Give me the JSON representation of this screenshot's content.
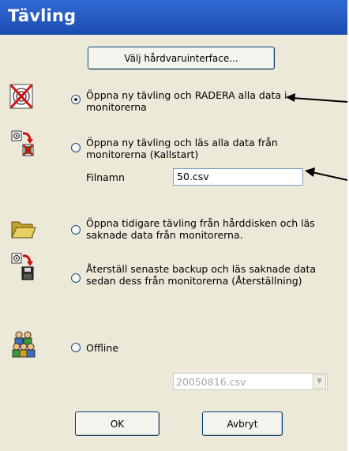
{
  "window": {
    "title": "Tävling"
  },
  "hw_button": {
    "label": "Välj hårdvaruinterface..."
  },
  "options": [
    {
      "text": "Öppna ny tävling och RADERA alla data i monitorerna",
      "checked": true,
      "icon": "wireless-delete-icon"
    },
    {
      "text": "Öppna ny tävling och läs alla data från monitorerna (Kallstart)",
      "checked": false,
      "icon": "read-monitor-cold-start-icon"
    },
    {
      "text": "Öppna tidigare tävling från hårddisken och läs saknade data från monitorerna.",
      "checked": false,
      "icon": "folder-open-icon"
    },
    {
      "text": "Återställ senaste backup och läs saknade data sedan dess från monitorerna (Återställning)",
      "checked": false,
      "icon": "restore-backup-icon"
    },
    {
      "text": "Offline",
      "checked": false,
      "icon": "people-offline-icon"
    }
  ],
  "filename": {
    "label": "Filnamn",
    "value": "50.csv"
  },
  "backup_select": {
    "value": "20050816.csv"
  },
  "buttons": {
    "ok": "OK",
    "cancel": "Avbryt"
  },
  "colors": {
    "title_bar": "#2b5fc7",
    "dialog_bg": "#ece9d8",
    "red": "#d01010"
  }
}
